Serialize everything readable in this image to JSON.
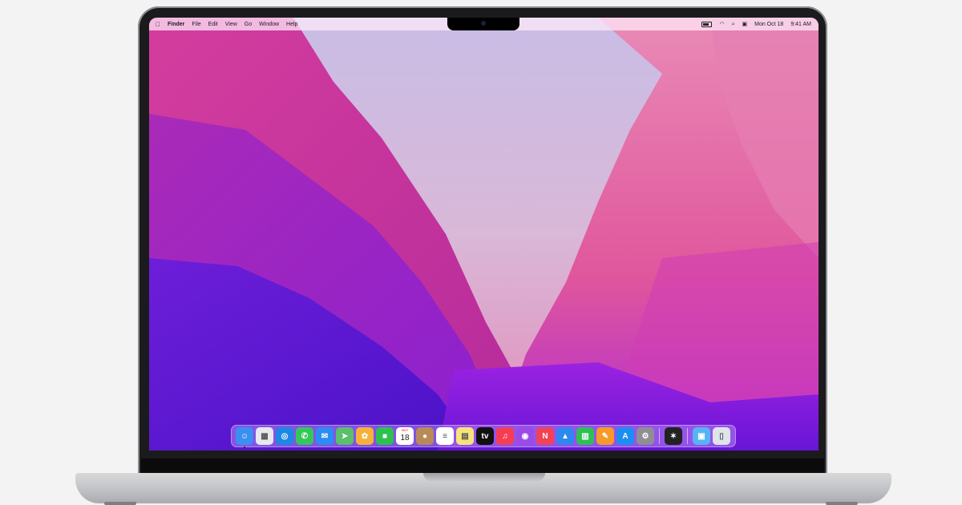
{
  "menubar": {
    "apple_icon": "apple-logo-icon",
    "items": [
      "Finder",
      "File",
      "Edit",
      "View",
      "Go",
      "Window",
      "Help"
    ],
    "status_icons": [
      "battery-icon",
      "wifi-icon",
      "search-icon",
      "control-center-icon"
    ],
    "date": "Mon Oct 18",
    "time": "9:41 AM"
  },
  "dock": {
    "apps": [
      {
        "name": "finder-icon",
        "color": "#3a8ff0",
        "glyph": "☺"
      },
      {
        "name": "launchpad-icon",
        "color": "#e8e8ef",
        "glyph": "▦"
      },
      {
        "name": "safari-icon",
        "color": "#1d87e5",
        "glyph": "◎"
      },
      {
        "name": "messages-icon",
        "color": "#35c759",
        "glyph": "✆"
      },
      {
        "name": "mail-icon",
        "color": "#2b8cf3",
        "glyph": "✉"
      },
      {
        "name": "maps-icon",
        "color": "#5bbf6b",
        "glyph": "➤"
      },
      {
        "name": "photos-icon",
        "color": "#f6b13c",
        "glyph": "✿"
      },
      {
        "name": "facetime-icon",
        "color": "#2ec150",
        "glyph": "■"
      },
      {
        "name": "calendar-icon",
        "color": "#ffffff",
        "glyph": ""
      },
      {
        "name": "contacts-icon",
        "color": "#b88a5a",
        "glyph": "●"
      },
      {
        "name": "reminders-icon",
        "color": "#ffffff",
        "glyph": "≡"
      },
      {
        "name": "notes-icon",
        "color": "#f8e27a",
        "glyph": "▤"
      },
      {
        "name": "tv-icon",
        "color": "#111111",
        "glyph": "tv"
      },
      {
        "name": "music-icon",
        "color": "#f63d54",
        "glyph": "♫"
      },
      {
        "name": "podcasts-icon",
        "color": "#9a4ae6",
        "glyph": "◉"
      },
      {
        "name": "news-icon",
        "color": "#f24256",
        "glyph": "N"
      },
      {
        "name": "keynote-icon",
        "color": "#2f87f0",
        "glyph": "▲"
      },
      {
        "name": "numbers-icon",
        "color": "#2fbf55",
        "glyph": "▥"
      },
      {
        "name": "pages-icon",
        "color": "#f59a2b",
        "glyph": "✎"
      },
      {
        "name": "app-store-icon",
        "color": "#1c8ef2",
        "glyph": "A"
      },
      {
        "name": "system-preferences-icon",
        "color": "#8e8e93",
        "glyph": "⚙"
      }
    ],
    "extras": [
      {
        "name": "final-cut-pro-icon",
        "color": "#222222",
        "glyph": "✶"
      }
    ],
    "folders": [
      {
        "name": "downloads-folder-icon",
        "color": "#57b3f3",
        "glyph": "▣"
      },
      {
        "name": "trash-icon",
        "color": "#dfe3ea",
        "glyph": "▯"
      }
    ],
    "calendar_month": "OCT",
    "calendar_day": "18"
  }
}
